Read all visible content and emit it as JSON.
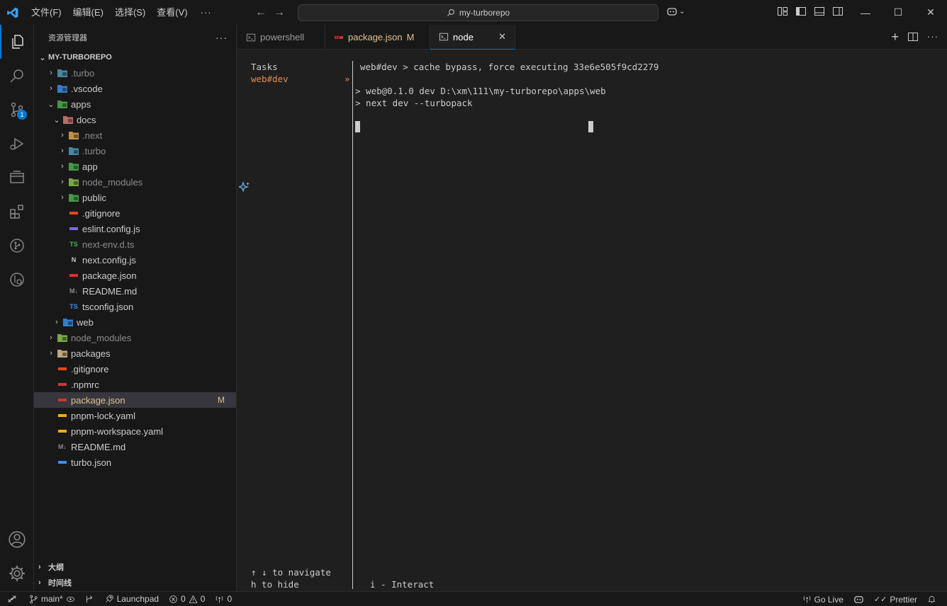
{
  "titlebar": {
    "menus": [
      "文件(F)",
      "编辑(E)",
      "选择(S)",
      "查看(V)"
    ],
    "more": "···",
    "search_text": "my-turborepo",
    "window_controls": [
      "—",
      "☐",
      "✕"
    ]
  },
  "activity": {
    "scm_badge": "1"
  },
  "sidebar": {
    "title": "资源管理器",
    "more": "···",
    "root": "MY-TURBOREPO",
    "tree": [
      {
        "label": ".turbo",
        "depth": 0,
        "chev": "›",
        "dim": true,
        "icon": "turbo-folder-icon",
        "color": "#519aba"
      },
      {
        "label": ".vscode",
        "depth": 0,
        "chev": "›",
        "dim": false,
        "icon": "vscode-folder-icon",
        "color": "#3b8eea"
      },
      {
        "label": "apps",
        "depth": 0,
        "chev": "⌄",
        "dim": false,
        "icon": "apps-folder-icon",
        "color": "#4caf50"
      },
      {
        "label": "docs",
        "depth": 1,
        "chev": "⌄",
        "dim": false,
        "icon": "docs-folder-icon",
        "color": "#d67a7a"
      },
      {
        "label": ".next",
        "depth": 2,
        "chev": "›",
        "dim": true,
        "icon": "next-folder-icon",
        "color": "#e0a84a"
      },
      {
        "label": ".turbo",
        "depth": 2,
        "chev": "›",
        "dim": true,
        "icon": "turbo-folder-icon",
        "color": "#519aba"
      },
      {
        "label": "app",
        "depth": 2,
        "chev": "›",
        "dim": false,
        "icon": "app-folder-icon",
        "color": "#4caf50"
      },
      {
        "label": "node_modules",
        "depth": 2,
        "chev": "›",
        "dim": true,
        "icon": "node-modules-folder-icon",
        "color": "#8bc34a"
      },
      {
        "label": "public",
        "depth": 2,
        "chev": "›",
        "dim": false,
        "icon": "public-folder-icon",
        "color": "#4caf50"
      },
      {
        "label": ".gitignore",
        "depth": 2,
        "chev": "",
        "dim": false,
        "icon": "git-icon",
        "color": "#e64a19"
      },
      {
        "label": "eslint.config.js",
        "depth": 2,
        "chev": "",
        "dim": false,
        "icon": "eslint-icon",
        "color": "#7c6cd9"
      },
      {
        "label": "next-env.d.ts",
        "depth": 2,
        "chev": "",
        "dim": true,
        "icon": "typescript-def-icon",
        "color": "#4caf50",
        "glyph": "TS"
      },
      {
        "label": "next.config.js",
        "depth": 2,
        "chev": "",
        "dim": false,
        "icon": "next-icon",
        "color": "#cccccc",
        "glyph": "N"
      },
      {
        "label": "package.json",
        "depth": 2,
        "chev": "",
        "dim": false,
        "icon": "npm-icon",
        "color": "#cb3837"
      },
      {
        "label": "README.md",
        "depth": 2,
        "chev": "",
        "dim": false,
        "icon": "markdown-icon",
        "color": "#8b8b8b",
        "glyph": "M↓"
      },
      {
        "label": "tsconfig.json",
        "depth": 2,
        "chev": "",
        "dim": false,
        "icon": "tsconfig-icon",
        "color": "#3b8eea",
        "glyph": "TS"
      },
      {
        "label": "web",
        "depth": 1,
        "chev": "›",
        "dim": false,
        "icon": "web-folder-icon",
        "color": "#3b8eea"
      },
      {
        "label": "node_modules",
        "depth": 0,
        "chev": "›",
        "dim": true,
        "icon": "node-modules-folder-icon",
        "color": "#8bc34a"
      },
      {
        "label": "packages",
        "depth": 0,
        "chev": "›",
        "dim": false,
        "icon": "packages-folder-icon",
        "color": "#e2c08d"
      },
      {
        "label": ".gitignore",
        "depth": 0,
        "chev": "",
        "dim": false,
        "icon": "git-icon",
        "color": "#e64a19"
      },
      {
        "label": ".npmrc",
        "depth": 0,
        "chev": "",
        "dim": false,
        "icon": "npm-icon",
        "color": "#cb3837"
      },
      {
        "label": "package.json",
        "depth": 0,
        "chev": "",
        "dim": false,
        "icon": "npm-icon",
        "color": "#cb3837",
        "modified": true,
        "selected": true,
        "mark": "M"
      },
      {
        "label": "pnpm-lock.yaml",
        "depth": 0,
        "chev": "",
        "dim": false,
        "icon": "pnpm-icon",
        "color": "#f9ad00"
      },
      {
        "label": "pnpm-workspace.yaml",
        "depth": 0,
        "chev": "",
        "dim": false,
        "icon": "pnpm-icon",
        "color": "#f9ad00"
      },
      {
        "label": "README.md",
        "depth": 0,
        "chev": "",
        "dim": false,
        "icon": "markdown-icon",
        "color": "#8b8b8b",
        "glyph": "M↓"
      },
      {
        "label": "turbo.json",
        "depth": 0,
        "chev": "",
        "dim": false,
        "icon": "turbo-icon",
        "color": "#3b8eea"
      }
    ],
    "outline": "大纲",
    "timeline": "时间线"
  },
  "tabs": [
    {
      "label": "powershell",
      "icon": "terminal-icon",
      "active": false
    },
    {
      "label": "package.json",
      "icon": "npm-icon",
      "active": false,
      "modified": "M"
    },
    {
      "label": "node",
      "icon": "terminal-icon",
      "active": true,
      "close": "✕"
    }
  ],
  "terminal": {
    "tasks_title": "Tasks",
    "task_item": "web#dev",
    "task_arrow": "»",
    "lines": [
      "web#dev > cache bypass, force executing 33e6e505f9cd2279",
      "> web@0.1.0 dev D:\\xm\\111\\my-turborepo\\apps\\web",
      "> next dev --turbopack"
    ],
    "help_navigate": "↑ ↓ to navigate",
    "help_hide": "h to hide",
    "help_interact": "i - Interact"
  },
  "statusbar": {
    "branch": "main*",
    "launchpad": "Launchpad",
    "errors": "0",
    "warnings": "0",
    "ports": "0",
    "golive": "Go Live",
    "prettier": "Prettier"
  }
}
